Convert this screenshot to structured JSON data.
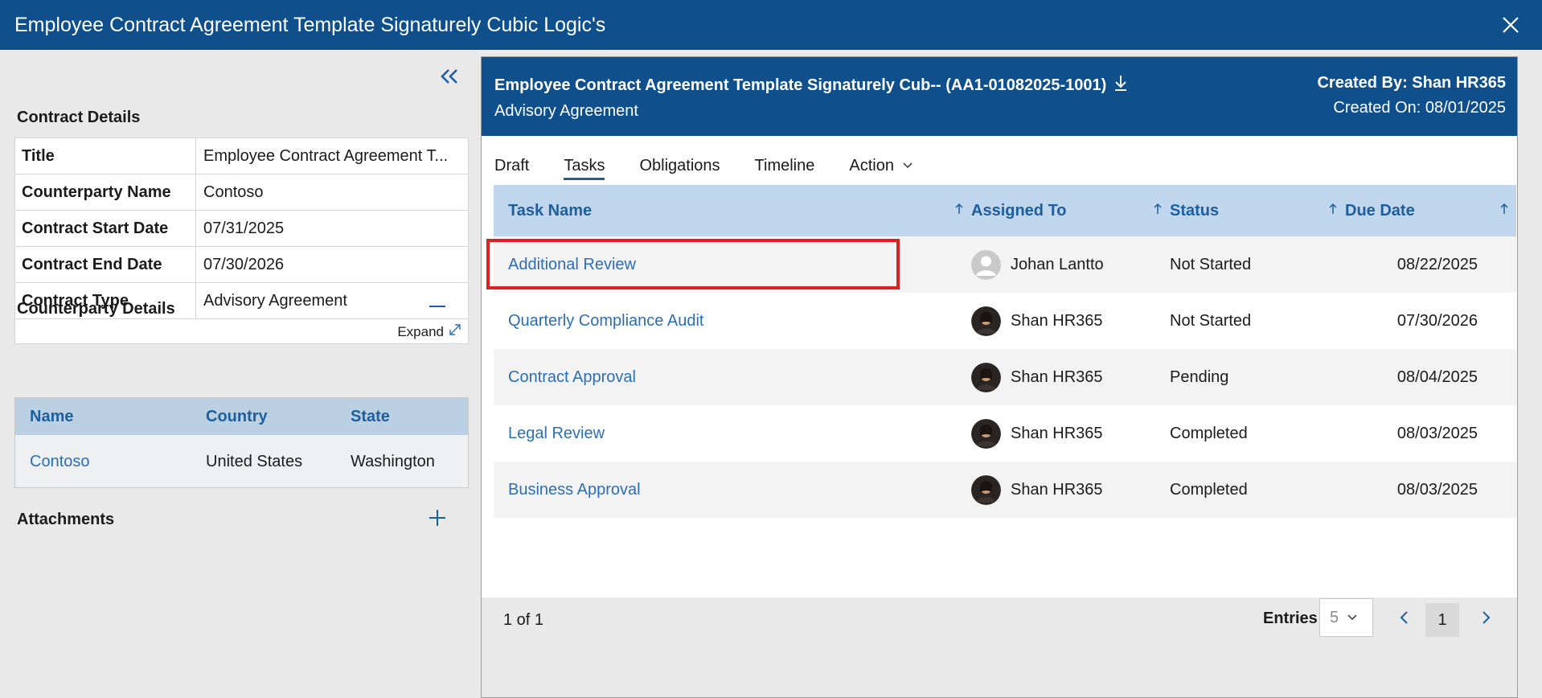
{
  "window": {
    "title": "Employee Contract Agreement Template Signaturely Cubic Logic's"
  },
  "left": {
    "contract_details_title": "Contract Details",
    "details": [
      {
        "label": "Title",
        "value": "Employee Contract Agreement T..."
      },
      {
        "label": "Counterparty Name",
        "value": "Contoso"
      },
      {
        "label": "Contract Start Date",
        "value": "07/31/2025"
      },
      {
        "label": "Contract End Date",
        "value": "07/30/2026"
      },
      {
        "label": "Contract Type",
        "value": "Advisory Agreement"
      }
    ],
    "expand_label": "Expand",
    "counterparty_title": "Counterparty Details",
    "counterparty_headers": {
      "name": "Name",
      "country": "Country",
      "state": "State"
    },
    "counterparty_row": {
      "name": "Contoso",
      "country": "United States",
      "state": "Washington"
    },
    "attachments_title": "Attachments"
  },
  "right": {
    "header_title": "Employee Contract Agreement Template Signaturely Cub-- (AA1-01082025-1001)",
    "header_subtitle": "Advisory Agreement",
    "created_by": "Created By: Shan HR365",
    "created_on": "Created On: 08/01/2025",
    "tabs": [
      {
        "label": "Draft",
        "active": false
      },
      {
        "label": "Tasks",
        "active": true
      },
      {
        "label": "Obligations",
        "active": false
      },
      {
        "label": "Timeline",
        "active": false
      },
      {
        "label": "Action",
        "active": false
      }
    ],
    "columns": {
      "task": "Task Name",
      "assigned": "Assigned To",
      "status": "Status",
      "due": "Due Date"
    },
    "rows": [
      {
        "task": "Additional Review",
        "assigned": "Johan Lantto",
        "status": "Not Started",
        "due": "08/22/2025"
      },
      {
        "task": "Quarterly Compliance Audit",
        "assigned": "Shan HR365",
        "status": "Not Started",
        "due": "07/30/2026"
      },
      {
        "task": "Contract Approval",
        "assigned": "Shan HR365",
        "status": "Pending",
        "due": "08/04/2025"
      },
      {
        "task": "Legal Review",
        "assigned": "Shan HR365",
        "status": "Completed",
        "due": "08/03/2025"
      },
      {
        "task": "Business Approval",
        "assigned": "Shan HR365",
        "status": "Completed",
        "due": "08/03/2025"
      }
    ],
    "footer": {
      "page_count": "1 of 1",
      "entries_label": "Entries",
      "entries_value": "5",
      "current_page": "1"
    }
  },
  "colors": {
    "header_blue": "#0f4f8c",
    "link_blue": "#2c6eb5",
    "grid_header": "#c0d6ec",
    "highlight_red": "#e02020"
  }
}
